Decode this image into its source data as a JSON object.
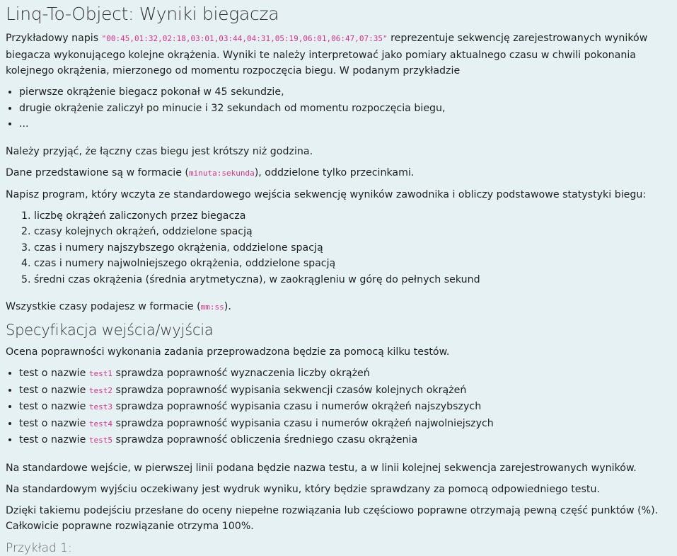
{
  "title": "Linq-To-Object: Wyniki biegacza",
  "intro": {
    "before": "Przykładowy napis ",
    "code": "\"00:45,01:32,02:18,03:01,03:44,04:31,05:19,06:01,06:47,07:35\"",
    "after": " reprezentuje sekwencję zarejestrowanych wyników biegacza wykonującego kolejne okrążenia. Wyniki te należy interpretować jako pomiary aktualnego czasu w chwili pokonania kolejnego okrążenia, mierzonego od momentu rozpoczęcia biegu. W podanym przykładzie"
  },
  "example_list": [
    "pierwsze okrążenie biegacz pokonał w 45 sekundzie,",
    "drugie okrążenie zaliczył po minucie i 32 sekundach od momentu rozpoczęcia biegu,",
    "..."
  ],
  "note_hour": "Należy przyjąć, że łączny czas biegu jest krótszy niż godzina.",
  "format_note": {
    "before": "Dane przedstawione są w formacie (",
    "code": "minuta:sekunda",
    "after": "), oddzielone tylko przecinkami."
  },
  "task": "Napisz program, który wczyta ze standardowego wejścia sekwencję wyników zawodnika i obliczy podstawowe statystyki biegu:",
  "stats_list": [
    "liczbę okrążeń zaliczonych przez biegacza",
    "czasy kolejnych okrążeń, oddzielone spacją",
    "czas i numery najszybszego okrążenia, oddzielone spacją",
    "czas i numery najwolniejszego okrążenia, oddzielone spacją",
    "średni czas okrążenia (średnia arytmetyczna), w zaokrągleniu w górę do pełnych sekund"
  ],
  "time_format": {
    "before": "Wszystkie czasy podajesz w formacie (",
    "code": "mm:ss",
    "after": ")."
  },
  "spec_heading": "Specyfikacja wejścia/wyjścia",
  "tests_intro": "Ocena poprawności wykonania zadania przeprowadzona będzie za pomocą kilku testów.",
  "tests": [
    {
      "before": "test o nazwie ",
      "code": "test1",
      "after": " sprawdza poprawność wyznaczenia liczby okrążeń"
    },
    {
      "before": "test o nazwie ",
      "code": "test2",
      "after": " sprawdza poprawność wypisania sekwencji czasów kolejnych okrążeń"
    },
    {
      "before": "test o nazwie ",
      "code": "test3",
      "after": " sprawdza poprawność wypisania czasu i numerów okrążeń najszybszych"
    },
    {
      "before": "test o nazwie ",
      "code": "test4",
      "after": " sprawdza poprawność wypisania czasu i numerów okrążeń najwolniejszych"
    },
    {
      "before": "test o nazwie ",
      "code": "test5",
      "after": " sprawdza poprawność obliczenia średniego czasu okrążenia"
    }
  ],
  "stdin_note": "Na standardowe wejście, w pierwszej linii podana będzie nazwa testu, a w linii kolejnej sekwencja zarejestrowanych wyników.",
  "stdout_note": "Na standardowym wyjściu oczekiwany jest wydruk wyniku, który będzie sprawdzany za pomocą odpowiedniego testu.",
  "scoring_note": "Dzięki takiemu podejściu przesłane do oceny niepełne rozwiązania lub częściowo poprawne otrzymają pewną część punktów (%). Całkowicie poprawne rozwiązanie otrzyma 100%.",
  "example_heading": "Przykład 1:"
}
